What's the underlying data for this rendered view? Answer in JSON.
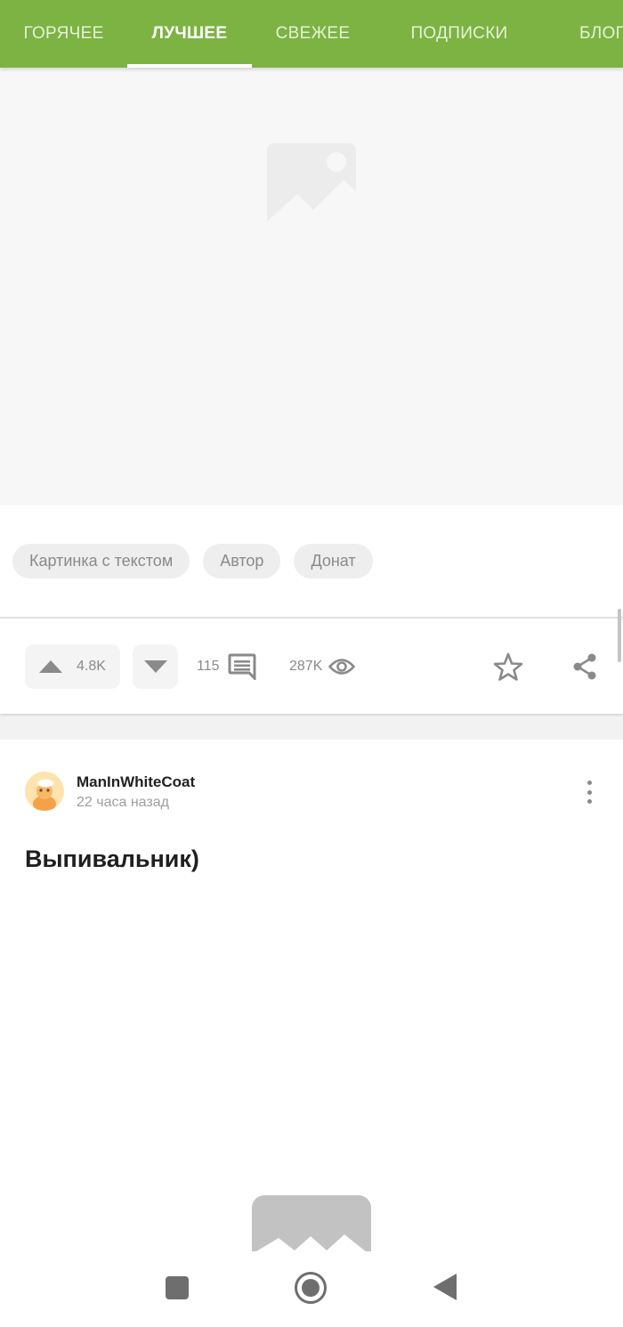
{
  "tabs": [
    {
      "label": "ГОРЯЧЕЕ",
      "active": false
    },
    {
      "label": "ЛУЧШЕЕ",
      "active": true
    },
    {
      "label": "СВЕЖЕЕ",
      "active": false
    },
    {
      "label": "ПОДПИСКИ",
      "active": false
    },
    {
      "label": "БЛОГ",
      "active": false
    }
  ],
  "post1": {
    "tags": [
      "Картинка с текстом",
      "Автор",
      "Донат"
    ],
    "rating": "4.8K",
    "comments": "115",
    "views": "287K"
  },
  "post2": {
    "author": "ManInWhiteCoat",
    "time": "22 часа назад",
    "title": "Выпивальник)"
  },
  "colors": {
    "accent": "#7cb342",
    "icon_gray": "#8a8a8a"
  },
  "icons": [
    "image-placeholder-icon",
    "upvote-icon",
    "downvote-icon",
    "comments-icon",
    "eye-icon",
    "star-icon",
    "share-icon",
    "more-icon",
    "nav-recents-icon",
    "nav-home-icon",
    "nav-back-icon"
  ]
}
